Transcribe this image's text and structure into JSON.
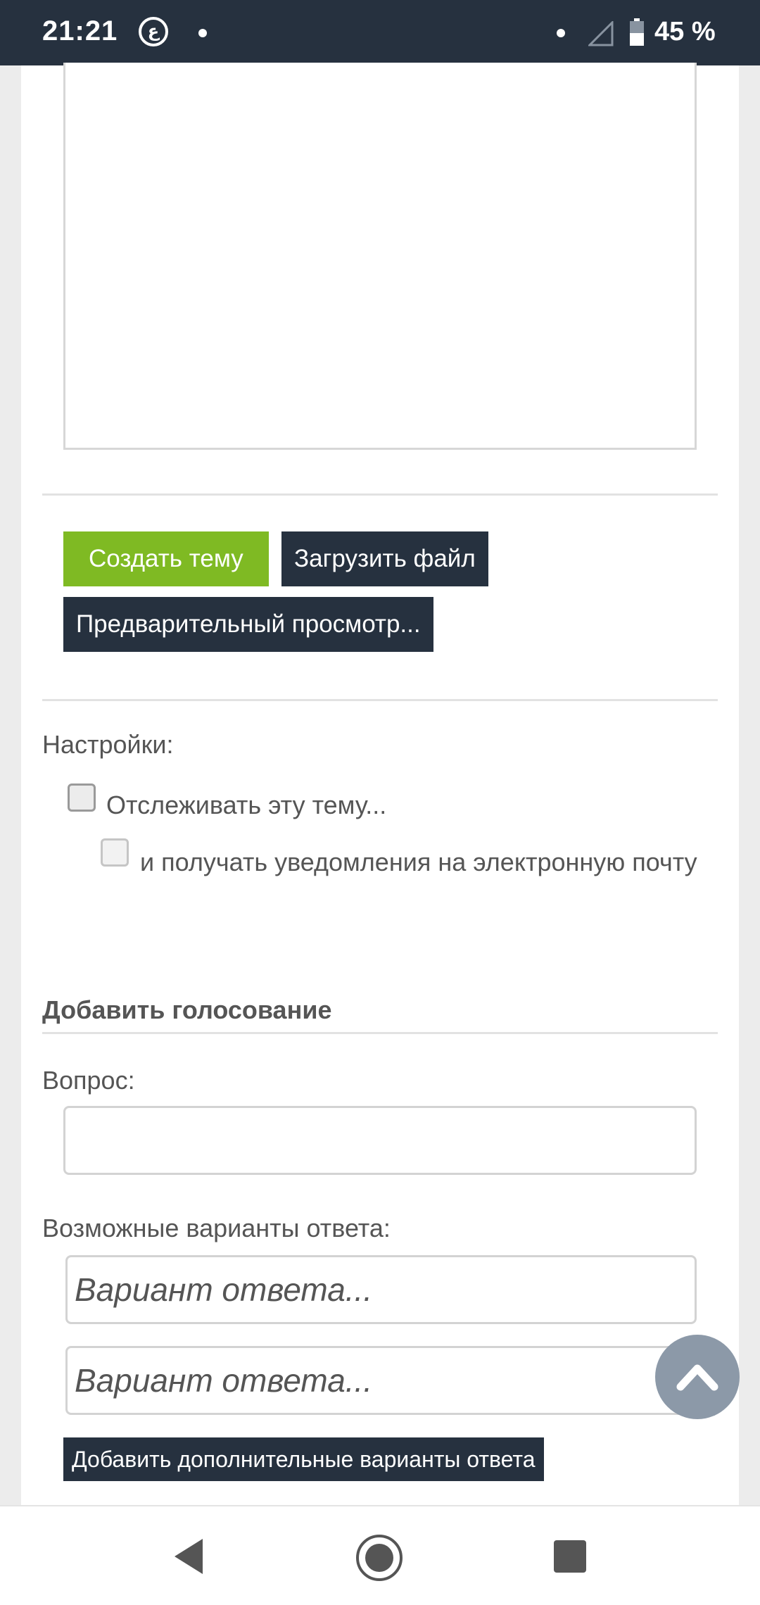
{
  "status_bar": {
    "time": "21:21",
    "app_icon_glyph": "ع",
    "battery_text": "45 %"
  },
  "buttons": {
    "create_topic": "Создать тему",
    "upload_file": "Загрузить файл",
    "preview": "Предварительный просмотр..."
  },
  "settings": {
    "label": "Настройки:",
    "watch_topic": "Отслеживать эту тему...",
    "email_notify": "и получать уведомления на электронную почту"
  },
  "poll": {
    "title": "Добавить голосование",
    "question_label": "Вопрос:",
    "options_label": "Возможные варианты ответа:",
    "option_placeholder_1": "Вариант ответа...",
    "option_placeholder_2": "Вариант ответа...",
    "add_more": "Добавить дополнительные варианты ответа"
  },
  "icons": {
    "scroll_top": "chevron-up-icon",
    "nav_back": "back-triangle-icon",
    "nav_home": "home-circle-icon",
    "nav_recents": "recents-square-icon"
  },
  "colors": {
    "primary_dark": "#26313f",
    "accent_green": "#7fba23",
    "fab": "#8c99a8"
  }
}
